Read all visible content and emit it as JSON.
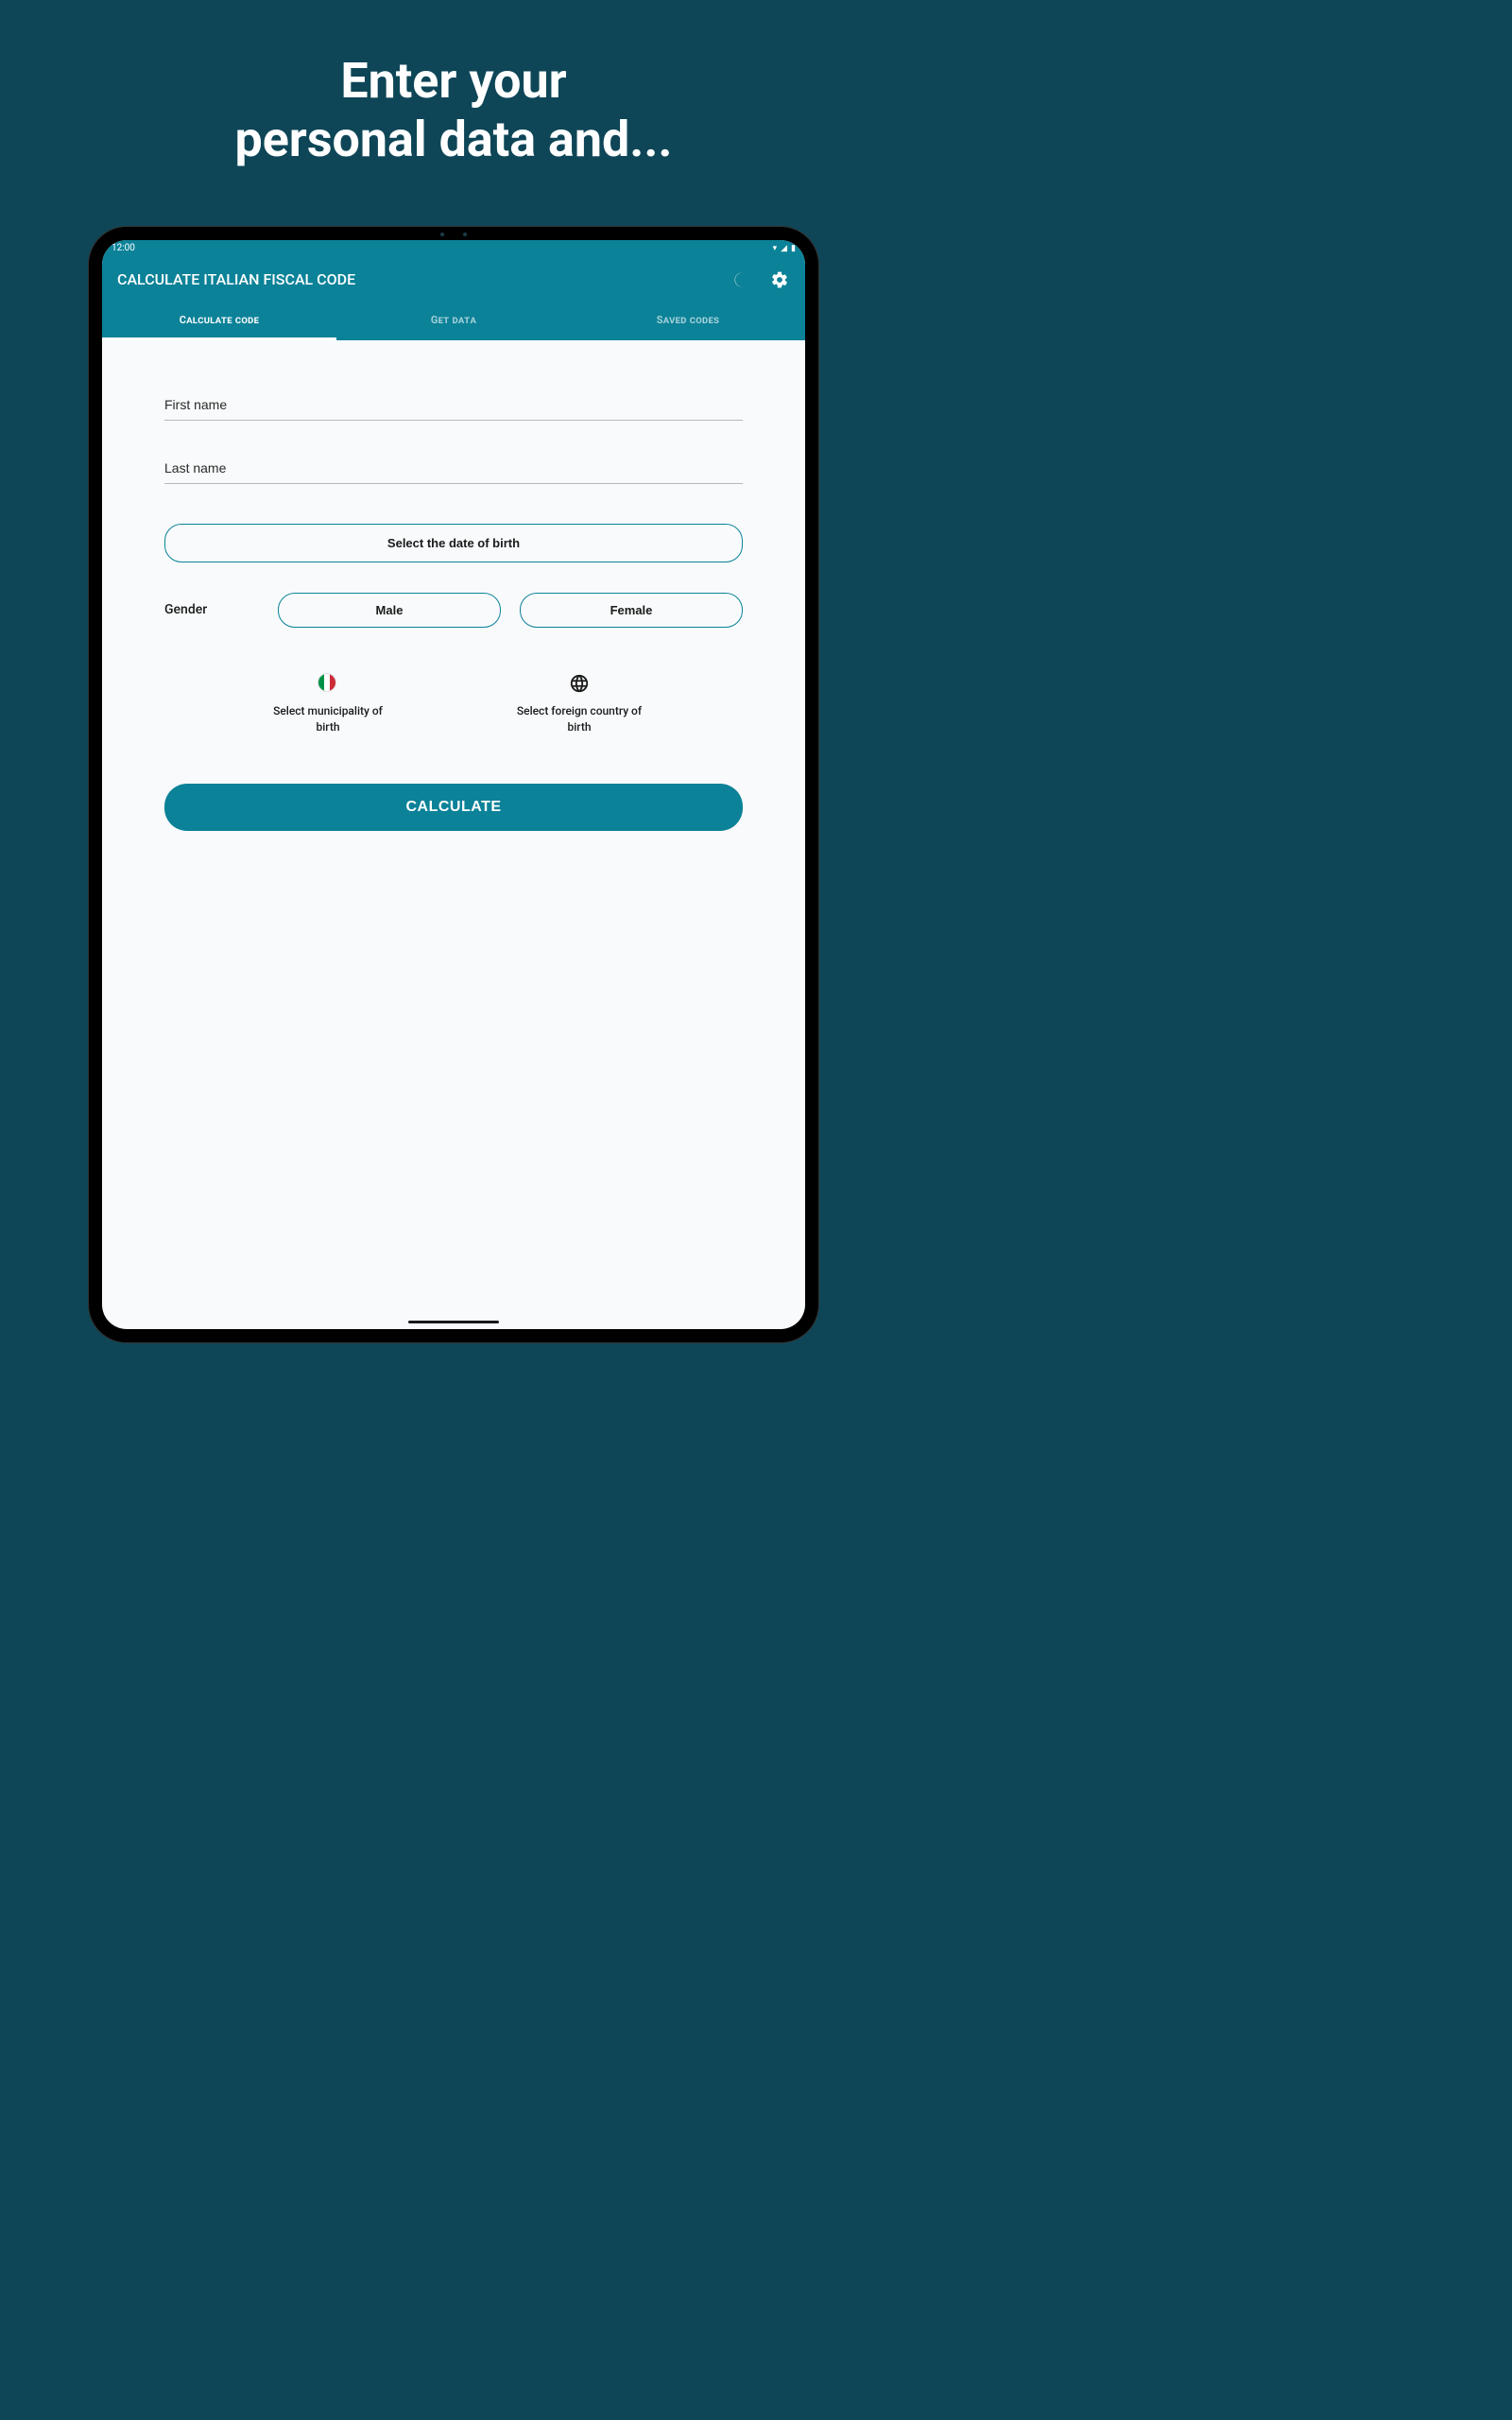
{
  "promo": {
    "line1": "Enter your",
    "line2": "personal data and..."
  },
  "status": {
    "time": "12:00"
  },
  "appbar": {
    "title": "CALCULATE ITALIAN FISCAL CODE"
  },
  "tabs": {
    "calculate": "Calculate code",
    "getdata": "Get data",
    "saved": "Saved codes"
  },
  "form": {
    "first_name_placeholder": "First name",
    "last_name_placeholder": "Last name",
    "dob_button": "Select the date of birth",
    "gender_label": "Gender",
    "male": "Male",
    "female": "Female",
    "municipality": "Select municipality of birth",
    "foreign": "Select foreign country of birth",
    "calculate": "CALCULATE"
  }
}
